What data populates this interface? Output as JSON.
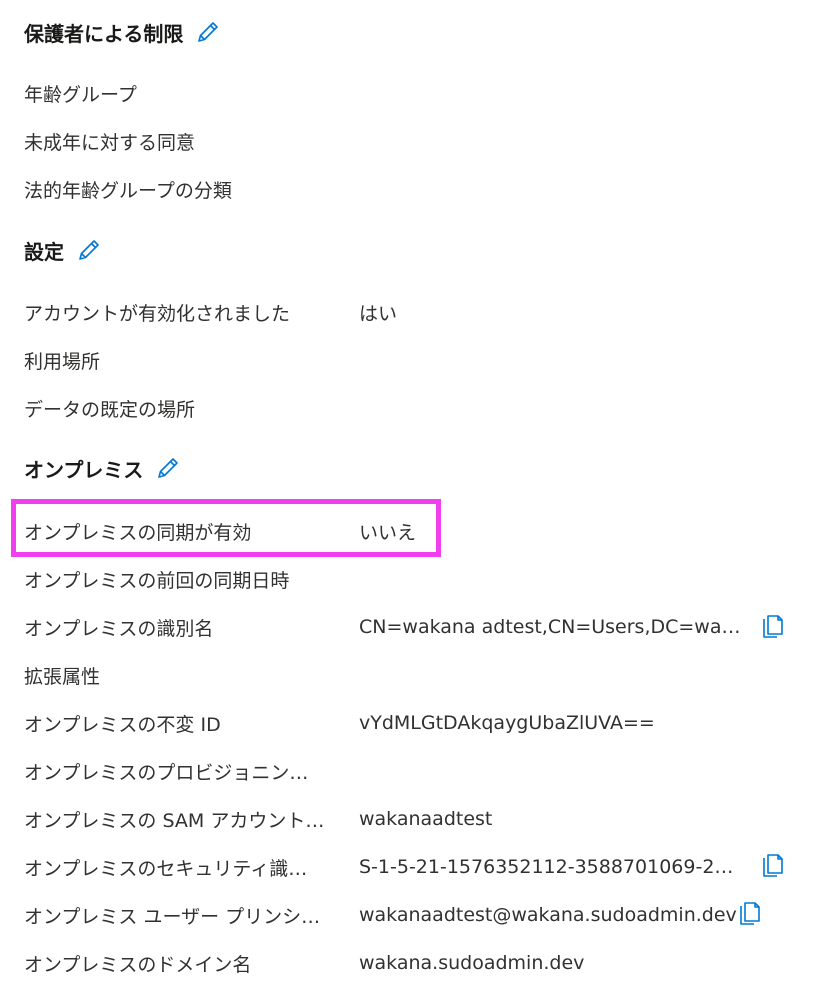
{
  "colors": {
    "accent": "#0078d4",
    "highlight": "#f13ff0"
  },
  "sections": {
    "parental": {
      "title": "保護者による制限",
      "icon": "pencil-edit-icon",
      "rows": {
        "age_group": {
          "label": "年齢グループ",
          "value": ""
        },
        "minor_consent": {
          "label": "未成年に対する同意",
          "value": ""
        },
        "legal_age_class": {
          "label": "法的年齢グループの分類",
          "value": ""
        }
      }
    },
    "settings": {
      "title": "設定",
      "icon": "pencil-edit-icon",
      "rows": {
        "account_enabled": {
          "label": "アカウントが有効化されました",
          "value": "はい"
        },
        "usage_location": {
          "label": "利用場所",
          "value": ""
        },
        "data_location": {
          "label": "データの既定の場所",
          "value": ""
        }
      }
    },
    "onprem": {
      "title": "オンプレミス",
      "icon": "pencil-edit-icon",
      "rows": {
        "sync_enabled": {
          "label": "オンプレミスの同期が有効",
          "value": "いいえ"
        },
        "last_sync": {
          "label": "オンプレミスの前回の同期日時",
          "value": ""
        },
        "dn": {
          "label": "オンプレミスの識別名",
          "value": "CN=wakana adtest,CN=Users,DC=waka…"
        },
        "ext_attrs": {
          "label": "拡張属性",
          "value": ""
        },
        "immutable_id": {
          "label": "オンプレミスの不変 ID",
          "value": "vYdMLGtDAkqaygUbaZlUVA=="
        },
        "provisioning": {
          "label": "オンプレミスのプロビジョニン…",
          "value": ""
        },
        "sam": {
          "label": "オンプレミスの SAM アカウント…",
          "value": "wakanaadtest"
        },
        "sid": {
          "label": "オンプレミスのセキュリティ識…",
          "value": "S-1-5-21-1576352112-3588701069-288…"
        },
        "upn": {
          "label": "オンプレミス ユーザー プリンシ…",
          "value": "wakanaadtest@wakana.sudoadmin.dev"
        },
        "domain": {
          "label": "オンプレミスのドメイン名",
          "value": "wakana.sudoadmin.dev"
        }
      }
    }
  },
  "copy_icon": "copy-icon"
}
